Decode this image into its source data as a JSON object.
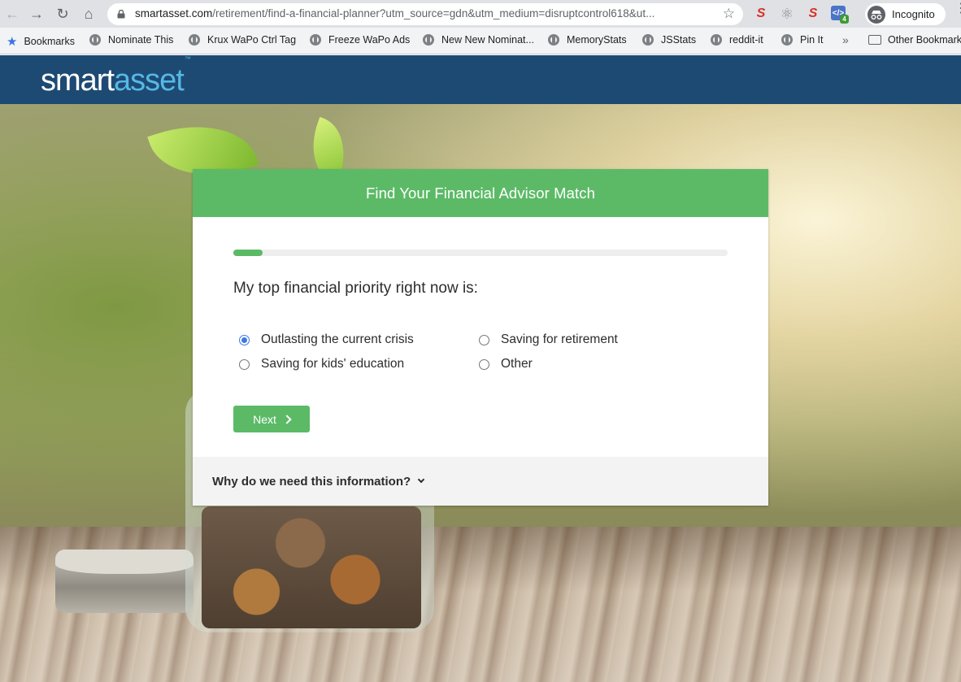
{
  "browser": {
    "url_host": "smartasset.com",
    "url_path": "/retirement/find-a-financial-planner?utm_source=gdn&utm_medium=disruptcontrol618&ut...",
    "profile_label": "Incognito",
    "extension_badge": "4",
    "bookmarks": [
      {
        "label": "Bookmarks",
        "icon": "star-icon"
      },
      {
        "label": "Nominate This",
        "icon": "globe-icon"
      },
      {
        "label": "Krux WaPo Ctrl Tag",
        "icon": "globe-icon"
      },
      {
        "label": "Freeze WaPo Ads",
        "icon": "globe-icon"
      },
      {
        "label": "New New Nominat...",
        "icon": "globe-icon"
      },
      {
        "label": "MemoryStats",
        "icon": "globe-icon"
      },
      {
        "label": "JSStats",
        "icon": "globe-icon"
      },
      {
        "label": "reddit-it",
        "icon": "globe-icon"
      },
      {
        "label": "Pin It",
        "icon": "globe-icon"
      }
    ],
    "overflow_label": "»",
    "other_bookmarks": "Other Bookmarks"
  },
  "site": {
    "logo_part1": "smart",
    "logo_part2": "asset",
    "logo_tm": "™"
  },
  "form": {
    "title": "Find Your Financial Advisor Match",
    "progress_fraction": 0.06,
    "question": "My top financial priority right now is:",
    "options": [
      {
        "label": "Outlasting the current crisis",
        "checked": true
      },
      {
        "label": "Saving for retirement",
        "checked": false
      },
      {
        "label": "Saving for kids' education",
        "checked": false
      },
      {
        "label": "Other",
        "checked": false
      }
    ],
    "next_label": "Next",
    "why_label": "Why do we need this information?"
  },
  "colors": {
    "brand_green": "#5cba67",
    "header_navy": "#1d4a73",
    "radio_blue": "#3b78e7"
  }
}
